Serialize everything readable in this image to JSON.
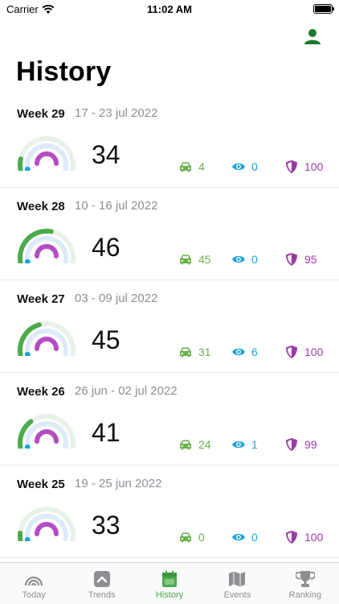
{
  "status": {
    "carrier": "Carrier",
    "time": "11:02 AM"
  },
  "header": {
    "title": "History"
  },
  "colors": {
    "green": "#4aab4a",
    "blue": "#1aa3d9",
    "purple": "#9b3aa7",
    "drive_green": "#6ab04c"
  },
  "weeks": [
    {
      "label": "Week 29",
      "range": "17 - 23 jul 2022",
      "score": "34",
      "drive": "4",
      "view": "0",
      "safety": "100",
      "gauge_fill": 0.12
    },
    {
      "label": "Week 28",
      "range": "10 - 16 jul 2022",
      "score": "46",
      "drive": "45",
      "view": "0",
      "safety": "95",
      "gauge_fill": 0.55
    },
    {
      "label": "Week 27",
      "range": "03 - 09 jul 2022",
      "score": "45",
      "drive": "31",
      "view": "6",
      "safety": "100",
      "gauge_fill": 0.42
    },
    {
      "label": "Week 26",
      "range": "26 jun - 02 jul 2022",
      "score": "41",
      "drive": "24",
      "view": "1",
      "safety": "99",
      "gauge_fill": 0.32
    },
    {
      "label": "Week 25",
      "range": "19 - 25 jun 2022",
      "score": "33",
      "drive": "0",
      "view": "0",
      "safety": "100",
      "gauge_fill": 0.0
    }
  ],
  "tabbar": {
    "today": "Today",
    "trends": "Trends",
    "history": "History",
    "events": "Events",
    "ranking": "Ranking"
  },
  "icons": {
    "wifi": "wifi-icon",
    "battery": "battery-icon",
    "profile": "person-icon",
    "drive": "car-icon",
    "view": "eye-icon",
    "safety": "shield-icon",
    "today": "gauge-icon",
    "trends": "chevron-up-icon",
    "history": "calendar-icon",
    "events": "map-icon",
    "ranking": "trophy-icon"
  }
}
